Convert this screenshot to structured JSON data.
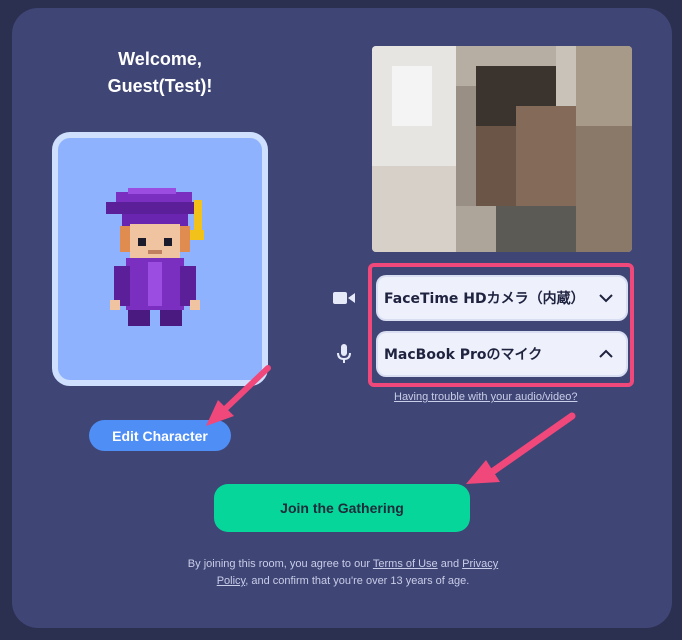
{
  "welcome": {
    "line1": "Welcome,",
    "line2": "Guest(Test)!"
  },
  "avatar": {
    "edit_label": "Edit Character"
  },
  "devices": {
    "camera_label": "FaceTime HDカメラ（内蔵）",
    "microphone_label": "MacBook Proのマイク",
    "trouble_link": "Having trouble with your audio/video?"
  },
  "join": {
    "label": "Join the Gathering"
  },
  "terms": {
    "prefix": "By joining this room, you agree to our ",
    "terms_link": "Terms of Use",
    "and": " and ",
    "privacy_link_1": "Privacy",
    "privacy_link_2": "Policy",
    "suffix": ", and confirm that you're over 13 years of age."
  },
  "colors": {
    "background": "#2b3050",
    "card": "#3f4575",
    "accent_green": "#06d69a",
    "accent_blue": "#4f8ef5",
    "annotation_pink": "#f0487a"
  }
}
